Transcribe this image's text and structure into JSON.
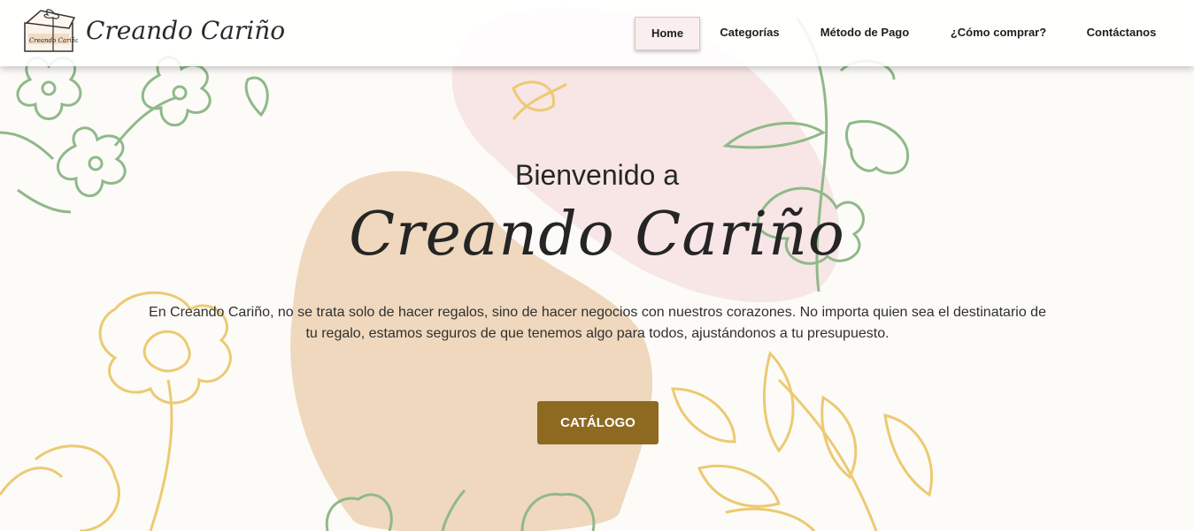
{
  "header": {
    "brand": "Creando Cariño",
    "logo_caption": "Creando Cariño",
    "nav": [
      "Home",
      "Categorías",
      "Método de Pago",
      "¿Cómo comprar?",
      "Contáctanos"
    ],
    "active_nav": "Home"
  },
  "hero": {
    "welcome": "Bienvenido a",
    "title": "Creando Cariño",
    "description": "En Creando Cariño, no se trata solo de hacer regalos, sino de hacer negocios con nuestros corazones. No importa quien sea el destinatario de tu regalo, estamos seguros de que tenemos algo para todos, ajustándonos a tu presupuesto.",
    "button": "CATÁLOGO"
  },
  "colors": {
    "button": "#8e6a21",
    "blob_pink": "#f8e7e6",
    "blob_tan": "#efd8bd",
    "line_green": "#8fb98a",
    "line_yellow": "#ecca73"
  },
  "icons": [
    "gift-box-logo-icon",
    "flower-decoration-icon"
  ]
}
